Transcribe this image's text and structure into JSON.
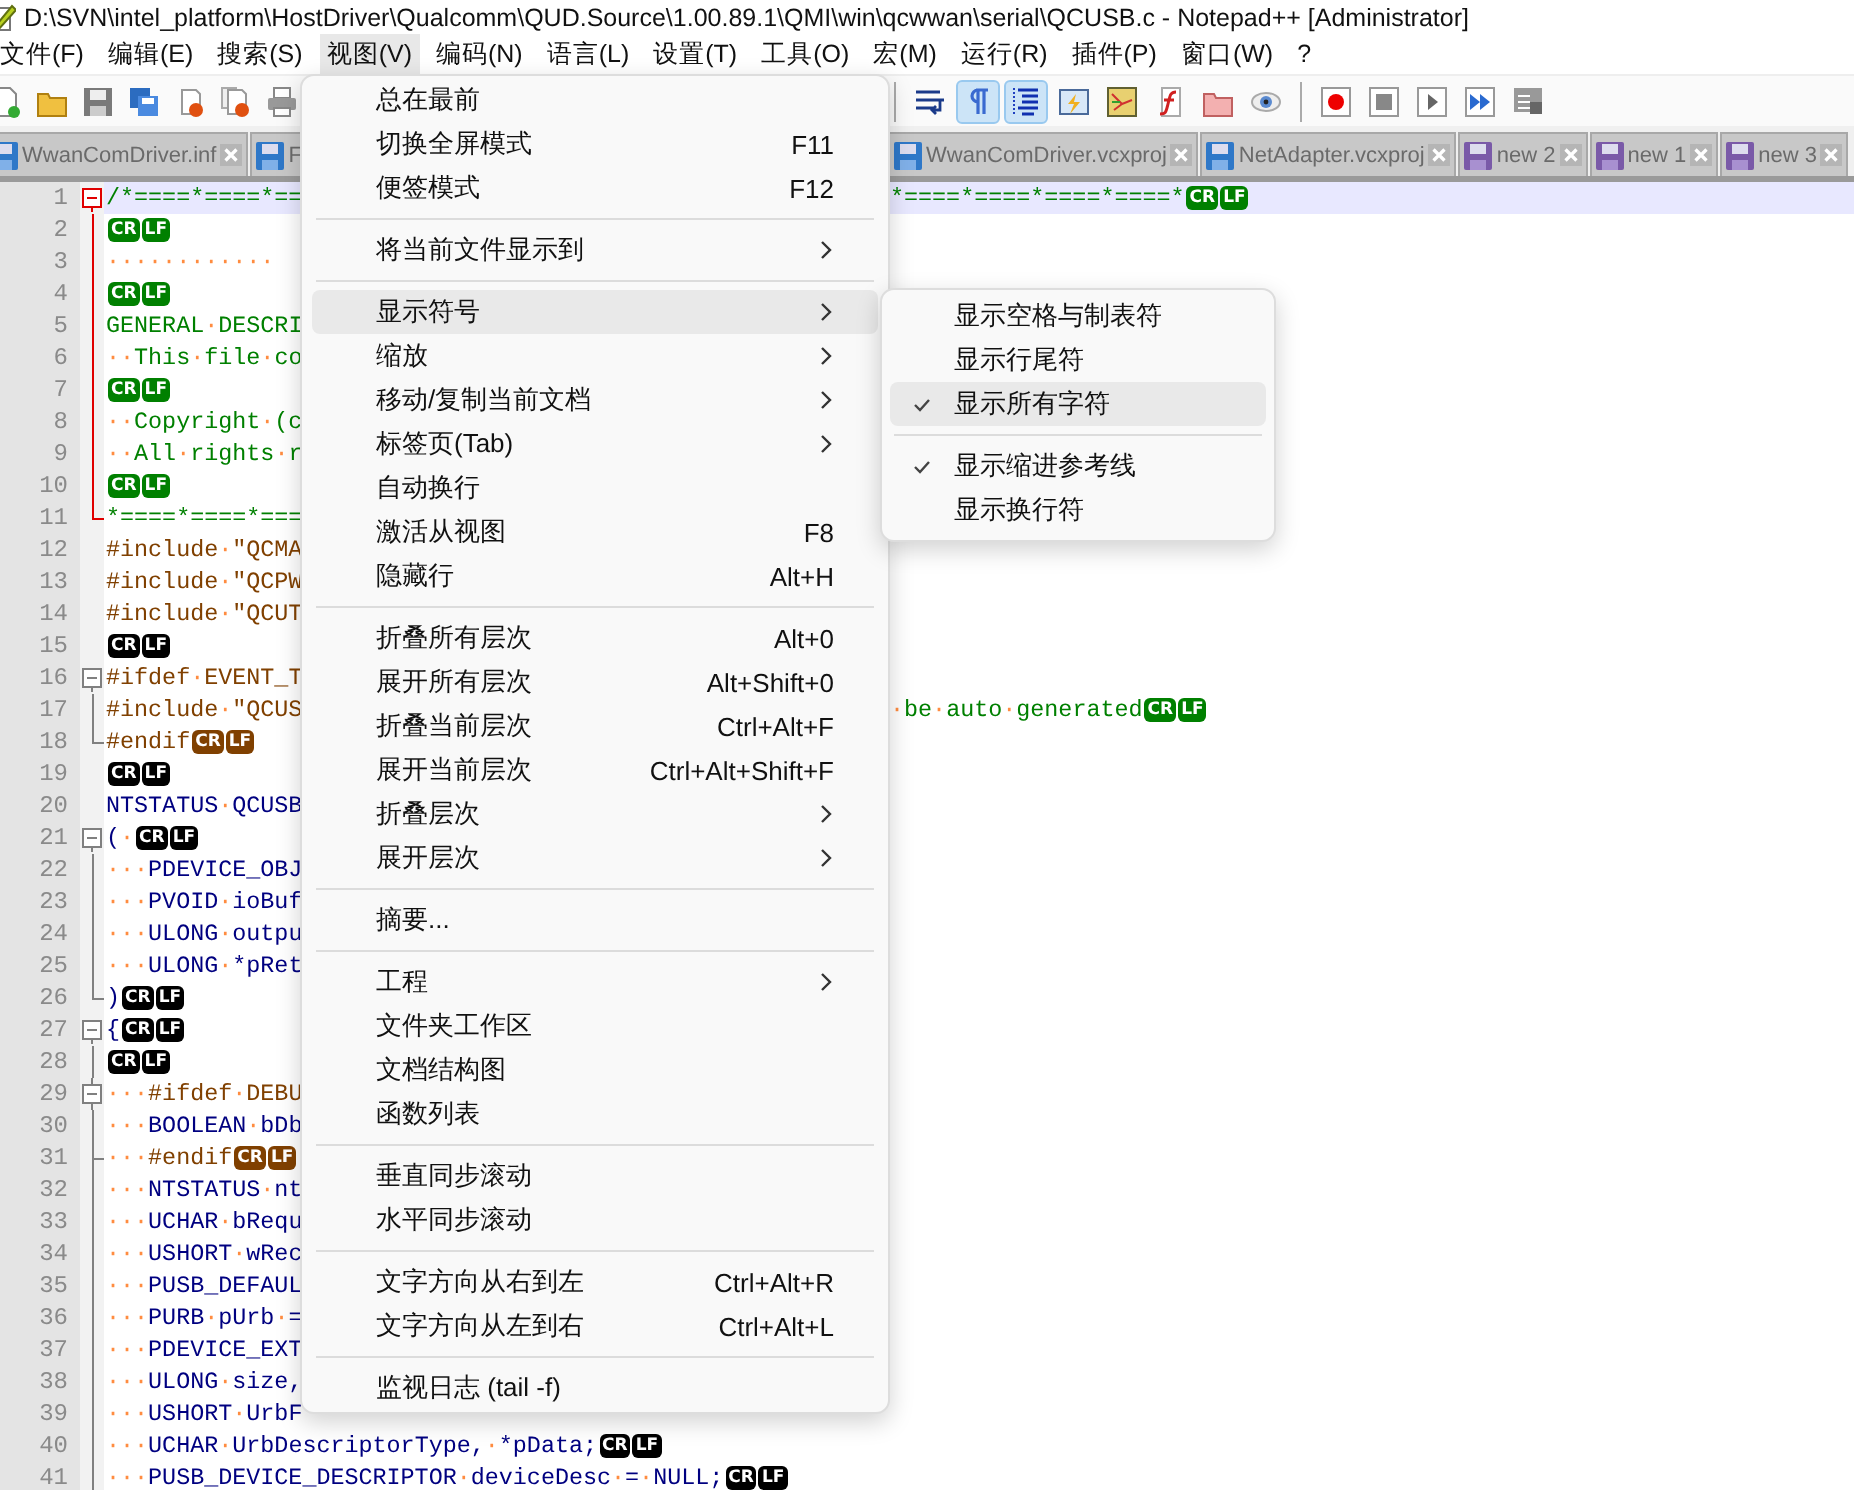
{
  "window": {
    "title": "D:\\SVN\\intel_platform\\HostDriver\\Qualcomm\\QUD.Source\\1.00.89.1\\QMI\\win\\qcwwan\\serial\\QCUSB.c - Notepad++ [Administrator]"
  },
  "menubar": [
    {
      "label": "文件(F)",
      "selected": false
    },
    {
      "label": "编辑(E)",
      "selected": false
    },
    {
      "label": "搜索(S)",
      "selected": false
    },
    {
      "label": "视图(V)",
      "selected": true
    },
    {
      "label": "编码(N)",
      "selected": false
    },
    {
      "label": "语言(L)",
      "selected": false
    },
    {
      "label": "设置(T)",
      "selected": false
    },
    {
      "label": "工具(O)",
      "selected": false
    },
    {
      "label": "宏(M)",
      "selected": false
    },
    {
      "label": "运行(R)",
      "selected": false
    },
    {
      "label": "插件(P)",
      "selected": false
    },
    {
      "label": "窗口(W)",
      "selected": false
    },
    {
      "label": "?",
      "selected": false
    }
  ],
  "toolbar_left": [
    {
      "kind": "new",
      "pressed": false
    },
    {
      "kind": "open",
      "pressed": false
    },
    {
      "kind": "save",
      "pressed": false
    },
    {
      "kind": "save-all",
      "pressed": false
    },
    {
      "kind": "close",
      "pressed": false
    },
    {
      "kind": "close-all",
      "pressed": false
    },
    {
      "kind": "print",
      "pressed": false
    }
  ],
  "toolbar_right": [
    {
      "kind": "divider"
    },
    {
      "kind": "wrap",
      "pressed": false
    },
    {
      "kind": "all-chars",
      "pressed": true
    },
    {
      "kind": "indent-guide",
      "pressed": true
    },
    {
      "kind": "udl",
      "pressed": false
    },
    {
      "kind": "doc-map",
      "pressed": false
    },
    {
      "kind": "function-list",
      "pressed": false
    },
    {
      "kind": "folder",
      "pressed": false
    },
    {
      "kind": "monitor",
      "pressed": false
    },
    {
      "kind": "divider"
    },
    {
      "kind": "record",
      "pressed": false
    },
    {
      "kind": "stop",
      "pressed": false
    },
    {
      "kind": "play",
      "pressed": false
    },
    {
      "kind": "play-multi",
      "pressed": false
    },
    {
      "kind": "save-macro",
      "pressed": false
    }
  ],
  "tabs_left": [
    {
      "label": "WwanComDriver.inf",
      "kind": "file"
    },
    {
      "label": "F",
      "kind": "file"
    }
  ],
  "tabs_right": [
    {
      "label": "WwanComDriver.vcxproj",
      "kind": "file"
    },
    {
      "label": "NetAdapter.vcxproj",
      "kind": "file"
    },
    {
      "label": "new 2",
      "kind": "new"
    },
    {
      "label": "new 1",
      "kind": "new"
    },
    {
      "label": "new 3",
      "kind": "new"
    }
  ],
  "lines": [
    {
      "n": "1",
      "text": "/*====*====*==",
      "kind": "comment",
      "fold": {
        "kind": "start",
        "active": true
      },
      "current": true,
      "right": {
        "text": "*====*====*====*====*",
        "kind": "comment",
        "eol": {
          "kind": "comment",
          "marks": [
            "CR",
            "LF"
          ]
        }
      }
    },
    {
      "n": "2",
      "fold": {
        "kind": "mid",
        "active": true
      },
      "current": false,
      "eol": {
        "kind": "comment",
        "marks": [
          "CR",
          "LF"
        ]
      }
    },
    {
      "n": "3",
      "text": "············",
      "kind": "comment",
      "fold": {
        "kind": "mid",
        "active": true
      },
      "current": false
    },
    {
      "n": "4",
      "fold": {
        "kind": "mid",
        "active": true
      },
      "current": false,
      "eol": {
        "kind": "comment",
        "marks": [
          "CR",
          "LF"
        ]
      }
    },
    {
      "n": "5",
      "text": "GENERAL·DESCRI",
      "kind": "comment",
      "fold": {
        "kind": "mid",
        "active": true
      },
      "current": false
    },
    {
      "n": "6",
      "text": "··This·file·co",
      "kind": "comment",
      "fold": {
        "kind": "mid",
        "active": true
      },
      "current": false
    },
    {
      "n": "7",
      "fold": {
        "kind": "mid",
        "active": true
      },
      "current": false,
      "eol": {
        "kind": "comment",
        "marks": [
          "CR",
          "LF"
        ]
      }
    },
    {
      "n": "8",
      "text": "··Copyright·(c",
      "kind": "comment",
      "fold": {
        "kind": "mid",
        "active": true
      },
      "current": false
    },
    {
      "n": "9",
      "text": "··All·rights·r",
      "kind": "comment",
      "fold": {
        "kind": "mid",
        "active": true
      },
      "current": false
    },
    {
      "n": "10",
      "fold": {
        "kind": "mid",
        "active": true
      },
      "current": false,
      "eol": {
        "kind": "comment",
        "marks": [
          "CR",
          "LF"
        ]
      }
    },
    {
      "n": "11",
      "text": "*====*====*===",
      "kind": "comment",
      "fold": {
        "kind": "end",
        "active": true
      },
      "current": false
    },
    {
      "n": "12",
      "text": "#include·\"QCMA",
      "kind": "preproc",
      "current": false
    },
    {
      "n": "13",
      "text": "#include·\"QCPW",
      "kind": "preproc",
      "current": false
    },
    {
      "n": "14",
      "text": "#include·\"QCUT",
      "kind": "preproc",
      "current": false
    },
    {
      "n": "15",
      "current": false,
      "eol": {
        "kind": "code",
        "marks": [
          "CR",
          "LF"
        ]
      }
    },
    {
      "n": "16",
      "text": "#ifdef·EVENT_T",
      "kind": "preproc",
      "fold": {
        "kind": "start",
        "active": false
      },
      "current": false
    },
    {
      "n": "17",
      "text": "#include·\"QCUS",
      "kind": "preproc",
      "fold": {
        "kind": "mid",
        "active": false
      },
      "current": false,
      "right": {
        "text": "·be·auto·generated",
        "kind": "comment",
        "eol": {
          "kind": "comment",
          "marks": [
            "CR",
            "LF"
          ]
        }
      }
    },
    {
      "n": "18",
      "text": "#endif",
      "kind": "preproc",
      "fold": {
        "kind": "end",
        "active": false
      },
      "current": false,
      "eol": {
        "kind": "preproc",
        "marks": [
          "CR",
          "LF"
        ]
      }
    },
    {
      "n": "19",
      "current": false,
      "eol": {
        "kind": "code",
        "marks": [
          "CR",
          "LF"
        ]
      }
    },
    {
      "n": "20",
      "text": "NTSTATUS·QCUSB",
      "kind": "code",
      "current": false
    },
    {
      "n": "21",
      "text": "(·",
      "kind": "code",
      "fold": {
        "kind": "start",
        "active": false
      },
      "current": false,
      "eol": {
        "kind": "code",
        "marks": [
          "CR",
          "LF"
        ]
      }
    },
    {
      "n": "22",
      "text": "···PDEVICE_OBJ",
      "kind": "code",
      "fold": {
        "kind": "mid",
        "active": false
      },
      "current": false
    },
    {
      "n": "23",
      "text": "···PVOID·ioBuf",
      "kind": "code",
      "fold": {
        "kind": "mid",
        "active": false
      },
      "current": false
    },
    {
      "n": "24",
      "text": "···ULONG·outpu",
      "kind": "code",
      "fold": {
        "kind": "mid",
        "active": false
      },
      "current": false
    },
    {
      "n": "25",
      "text": "···ULONG·*pRet",
      "kind": "code",
      "fold": {
        "kind": "mid",
        "active": false
      },
      "current": false
    },
    {
      "n": "26",
      "text": ")",
      "kind": "code",
      "fold": {
        "kind": "end",
        "active": false
      },
      "current": false,
      "eol": {
        "kind": "code",
        "marks": [
          "CR",
          "LF"
        ]
      }
    },
    {
      "n": "27",
      "text": "{",
      "kind": "code",
      "fold": {
        "kind": "start",
        "active": false
      },
      "current": false,
      "eol": {
        "kind": "code",
        "marks": [
          "CR",
          "LF"
        ]
      }
    },
    {
      "n": "28",
      "fold": {
        "kind": "mid",
        "active": false
      },
      "current": false,
      "eol": {
        "kind": "code",
        "marks": [
          "CR",
          "LF"
        ]
      }
    },
    {
      "n": "29",
      "text": "···#ifdef·DEBU",
      "kind": "preproc",
      "fold": {
        "kind": "start-inner",
        "active": false
      },
      "current": false
    },
    {
      "n": "30",
      "text": "···BOOLEAN·bDb",
      "kind": "code",
      "fold": {
        "kind": "mid",
        "active": false
      },
      "current": false
    },
    {
      "n": "31",
      "text": "···#endif",
      "kind": "preproc",
      "fold": {
        "kind": "tee",
        "active": false
      },
      "current": false,
      "eol": {
        "kind": "preproc",
        "marks": [
          "CR",
          "LF"
        ]
      }
    },
    {
      "n": "32",
      "text": "···NTSTATUS·nt",
      "kind": "code",
      "fold": {
        "kind": "mid",
        "active": false
      },
      "current": false
    },
    {
      "n": "33",
      "text": "···UCHAR·bRequ",
      "kind": "code",
      "fold": {
        "kind": "mid",
        "active": false
      },
      "current": false
    },
    {
      "n": "34",
      "text": "···USHORT·wRec",
      "kind": "code",
      "fold": {
        "kind": "mid",
        "active": false
      },
      "current": false
    },
    {
      "n": "35",
      "text": "···PUSB_DEFAUL",
      "kind": "code",
      "fold": {
        "kind": "mid",
        "active": false
      },
      "current": false
    },
    {
      "n": "36",
      "text": "···PURB·pUrb·=",
      "kind": "code",
      "fold": {
        "kind": "mid",
        "active": false
      },
      "current": false
    },
    {
      "n": "37",
      "text": "···PDEVICE_EXT",
      "kind": "code",
      "fold": {
        "kind": "mid",
        "active": false
      },
      "current": false
    },
    {
      "n": "38",
      "text": "···ULONG·size,",
      "kind": "code",
      "fold": {
        "kind": "mid",
        "active": false
      },
      "current": false
    },
    {
      "n": "39",
      "text": "···USHORT·UrbF",
      "kind": "code",
      "fold": {
        "kind": "mid",
        "active": false
      },
      "current": false
    },
    {
      "n": "40",
      "text": "···UCHAR·UrbDescriptorType,·*pData;",
      "kind": "code",
      "fold": {
        "kind": "mid",
        "active": false
      },
      "current": false,
      "eol": {
        "kind": "code",
        "marks": [
          "CR",
          "LF"
        ]
      }
    },
    {
      "n": "41",
      "text": "···PUSB_DEVICE_DESCRIPTOR·deviceDesc·=·NULL;",
      "kind": "code",
      "fold": {
        "kind": "mid",
        "active": false
      },
      "current": false,
      "eol": {
        "kind": "code",
        "marks": [
          "CR",
          "LF"
        ]
      }
    }
  ],
  "view_menu": [
    {
      "kind": "item",
      "label": "总在最前",
      "submenu": false,
      "selected": false
    },
    {
      "kind": "item",
      "label": "切换全屏模式",
      "shortcut": "F11",
      "submenu": false,
      "selected": false
    },
    {
      "kind": "item",
      "label": "便签模式",
      "shortcut": "F12",
      "submenu": false,
      "selected": false
    },
    {
      "kind": "separator"
    },
    {
      "kind": "item",
      "label": "将当前文件显示到",
      "submenu": true,
      "selected": false
    },
    {
      "kind": "separator"
    },
    {
      "kind": "item",
      "label": "显示符号",
      "submenu": true,
      "selected": true
    },
    {
      "kind": "item",
      "label": "缩放",
      "submenu": true,
      "selected": false
    },
    {
      "kind": "item",
      "label": "移动/复制当前文档",
      "submenu": true,
      "selected": false
    },
    {
      "kind": "item",
      "label": "标签页(Tab)",
      "submenu": true,
      "selected": false
    },
    {
      "kind": "item",
      "label": "自动换行",
      "submenu": false,
      "selected": false
    },
    {
      "kind": "item",
      "label": "激活从视图",
      "shortcut": "F8",
      "submenu": false,
      "selected": false
    },
    {
      "kind": "item",
      "label": "隐藏行",
      "shortcut": "Alt+H",
      "submenu": false,
      "selected": false
    },
    {
      "kind": "separator"
    },
    {
      "kind": "item",
      "label": "折叠所有层次",
      "shortcut": "Alt+0",
      "submenu": false,
      "selected": false
    },
    {
      "kind": "item",
      "label": "展开所有层次",
      "shortcut": "Alt+Shift+0",
      "submenu": false,
      "selected": false
    },
    {
      "kind": "item",
      "label": "折叠当前层次",
      "shortcut": "Ctrl+Alt+F",
      "submenu": false,
      "selected": false
    },
    {
      "kind": "item",
      "label": "展开当前层次",
      "shortcut": "Ctrl+Alt+Shift+F",
      "submenu": false,
      "selected": false
    },
    {
      "kind": "item",
      "label": "折叠层次",
      "submenu": true,
      "selected": false
    },
    {
      "kind": "item",
      "label": "展开层次",
      "submenu": true,
      "selected": false
    },
    {
      "kind": "separator"
    },
    {
      "kind": "item",
      "label": "摘要...",
      "submenu": false,
      "selected": false
    },
    {
      "kind": "separator"
    },
    {
      "kind": "item",
      "label": "工程",
      "submenu": true,
      "selected": false
    },
    {
      "kind": "item",
      "label": "文件夹工作区",
      "submenu": false,
      "selected": false
    },
    {
      "kind": "item",
      "label": "文档结构图",
      "submenu": false,
      "selected": false
    },
    {
      "kind": "item",
      "label": "函数列表",
      "submenu": false,
      "selected": false
    },
    {
      "kind": "separator"
    },
    {
      "kind": "item",
      "label": "垂直同步滚动",
      "submenu": false,
      "selected": false
    },
    {
      "kind": "item",
      "label": "水平同步滚动",
      "submenu": false,
      "selected": false
    },
    {
      "kind": "separator"
    },
    {
      "kind": "item",
      "label": "文字方向从右到左",
      "shortcut": "Ctrl+Alt+R",
      "submenu": false,
      "selected": false
    },
    {
      "kind": "item",
      "label": "文字方向从左到右",
      "shortcut": "Ctrl+Alt+L",
      "submenu": false,
      "selected": false
    },
    {
      "kind": "separator"
    },
    {
      "kind": "item",
      "label": "监视日志 (tail -f)",
      "submenu": false,
      "selected": false
    }
  ],
  "symbol_submenu": [
    {
      "kind": "item",
      "label": "显示空格与制表符",
      "checked": false,
      "selected": false
    },
    {
      "kind": "item",
      "label": "显示行尾符",
      "checked": false,
      "selected": false
    },
    {
      "kind": "item",
      "label": "显示所有字符",
      "checked": true,
      "selected": true
    },
    {
      "kind": "separator"
    },
    {
      "kind": "item",
      "label": "显示缩进参考线",
      "checked": true,
      "selected": false
    },
    {
      "kind": "item",
      "label": "显示换行符",
      "checked": false,
      "selected": false
    }
  ]
}
